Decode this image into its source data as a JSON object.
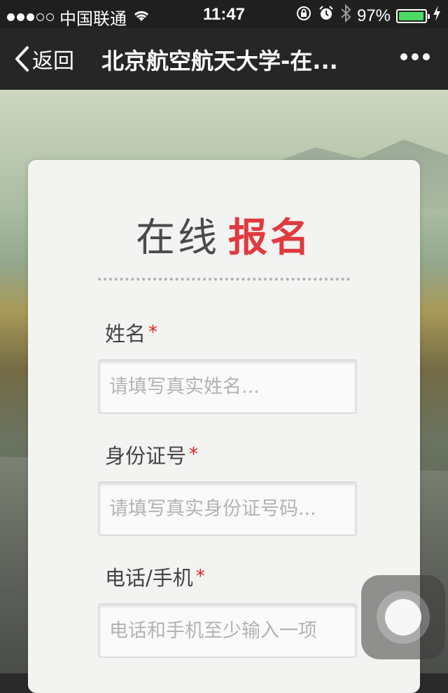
{
  "status_bar": {
    "carrier": "中国联通",
    "time": "11:47",
    "battery_percent": "97%",
    "battery_level": 0.97,
    "signal_bars_filled": 3,
    "signal_bars_total": 5,
    "icons": [
      "wifi-icon",
      "orientation-lock-icon",
      "alarm-icon",
      "bluetooth-icon",
      "charging-icon"
    ]
  },
  "nav": {
    "back_label": "返回",
    "title": "北京航空航天大学-在..."
  },
  "form": {
    "heading_plain": "在线",
    "heading_accent": "报名",
    "accent_color": "#e03a3e",
    "required_mark": "*",
    "fields": [
      {
        "label": "姓名",
        "placeholder": "请填写真实姓名...",
        "value": ""
      },
      {
        "label": "身份证号",
        "placeholder": "请填写真实身份证号码...",
        "value": ""
      },
      {
        "label": "电话/手机",
        "placeholder": "电话和手机至少输入一项",
        "value": ""
      }
    ]
  }
}
